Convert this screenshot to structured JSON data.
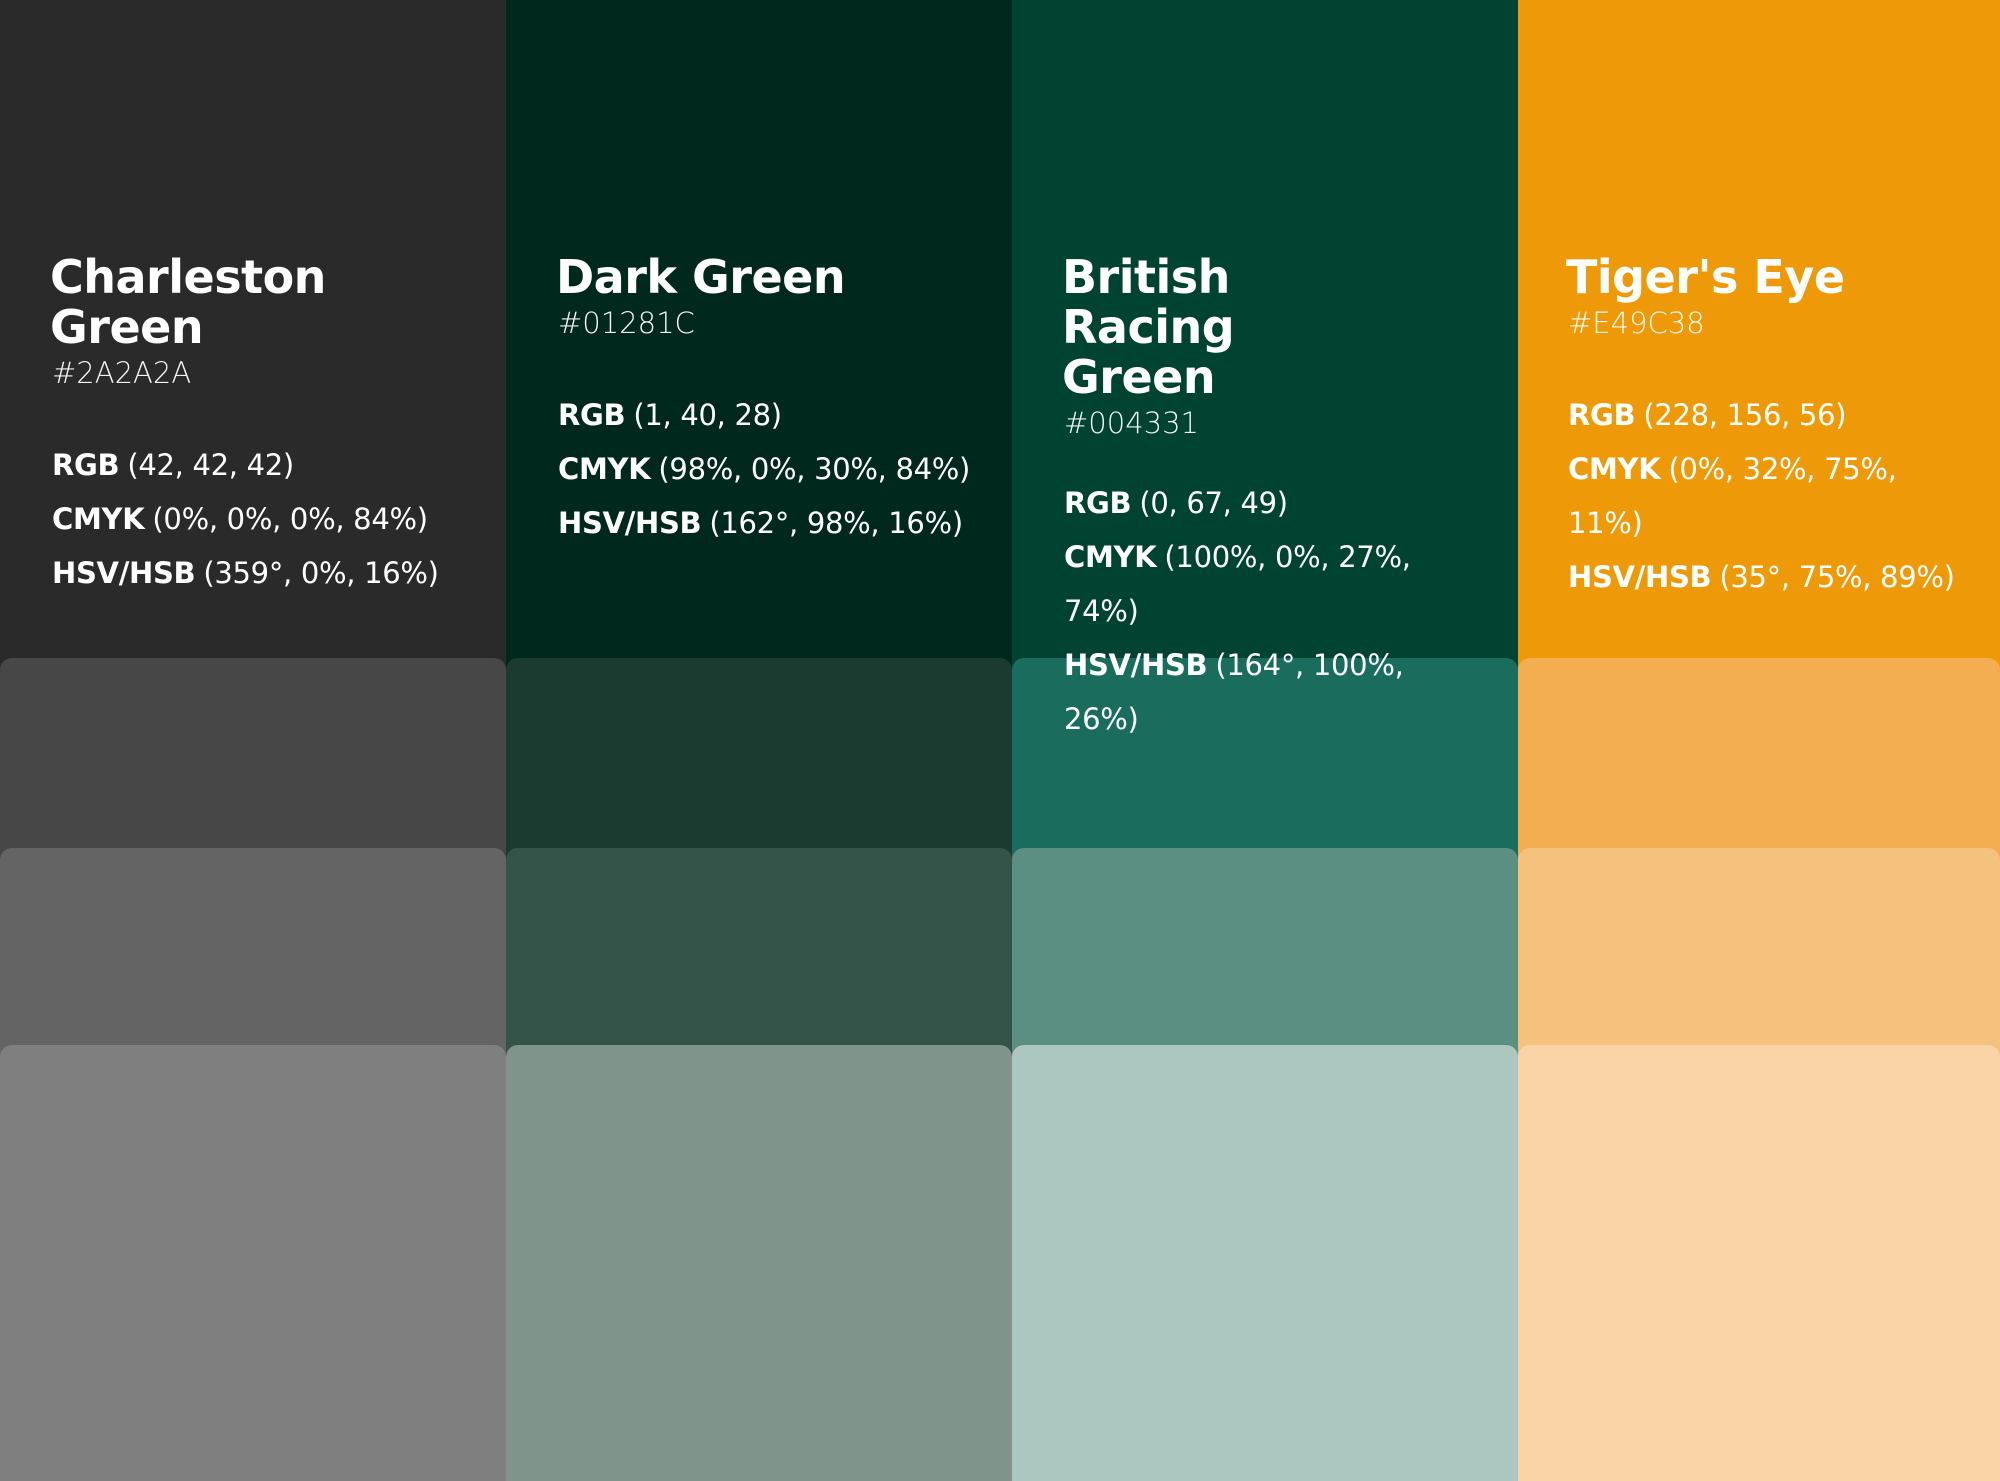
{
  "colors": [
    {
      "name": "Charleston Green",
      "hex": "#2A2A2A",
      "rgb_label": "RGB",
      "rgb": "(42, 42, 42)",
      "cmyk_label": "CMYK",
      "cmyk": "(0%, 0%, 0%, 84%)",
      "hsv_label": "HSV/HSB",
      "hsv": "(359°, 0%, 16%)",
      "swatch": "#2A2A2A",
      "tints": [
        "#474747",
        "#646464",
        "#7F7F7F"
      ]
    },
    {
      "name": "Dark Green",
      "hex": "#01281C",
      "rgb_label": "RGB",
      "rgb": "(1, 40, 28)",
      "cmyk_label": "CMYK",
      "cmyk": "(98%, 0%, 30%, 84%)",
      "hsv_label": "HSV/HSB",
      "hsv": "(162°, 98%, 16%)",
      "swatch": "#01281C",
      "tints": [
        "#1B3B31",
        "#345449",
        "#7F948B"
      ]
    },
    {
      "name": "British Racing Green",
      "hex": "#004331",
      "rgb_label": "RGB",
      "rgb": "(0, 67, 49)",
      "cmyk_label": "CMYK",
      "cmyk": "(100%, 0%, 27%, 74%)",
      "hsv_label": "HSV/HSB",
      "hsv": "(164°, 100%, 26%)",
      "swatch": "#004331",
      "tints": [
        "#1A6D5C",
        "#5A8F82",
        "#ACC6C0"
      ]
    },
    {
      "name": "Tiger's Eye",
      "hex": "#E49C38",
      "rgb_label": "RGB",
      "rgb": "(228, 156, 56)",
      "cmyk_label": "CMYK",
      "cmyk": "(0%, 32%, 75%, 11%)",
      "hsv_label": "HSV/HSB",
      "hsv": "(35°, 75%, 89%)",
      "swatch": "#EE9907",
      "tints": [
        "#F2AE51",
        "#F5C27D",
        "#FAD4A7"
      ]
    }
  ]
}
